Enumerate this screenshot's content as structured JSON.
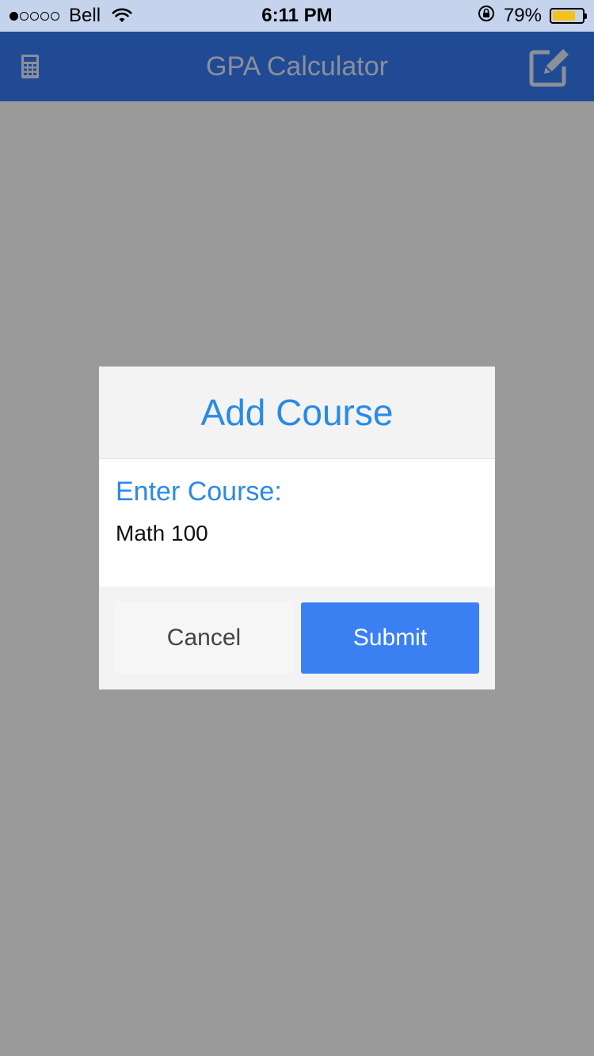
{
  "status_bar": {
    "carrier": "Bell",
    "time": "6:11 PM",
    "battery_percent": "79%",
    "battery_level": 0.79,
    "signal_bars_filled": 1,
    "signal_bars_total": 5
  },
  "nav": {
    "title": "GPA Calculator",
    "left_icon": "calculator-icon",
    "right_icon": "edit-icon"
  },
  "dialog": {
    "title": "Add Course",
    "field_label": "Enter Course:",
    "field_value": "Math 100",
    "cancel_label": "Cancel",
    "submit_label": "Submit"
  },
  "colors": {
    "status_bar_bg": "#c5d3ec",
    "nav_bg": "#204b94",
    "overlay_bg": "#9a9a9a",
    "accent": "#2a8ae8",
    "submit_bg": "#3a80f2",
    "battery_fill": "#f4c21a"
  }
}
